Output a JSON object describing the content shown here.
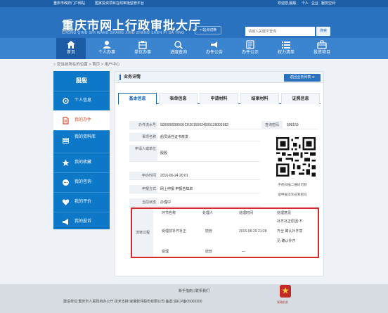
{
  "topbar": {
    "links_left": [
      "重庆市政府门户网站",
      "国家投资项目在线审批监管平台"
    ],
    "links_right": [
      "欢迎您,殷殷",
      "个人",
      "企业",
      "服务空间"
    ]
  },
  "header": {
    "logo_cn": "重庆市网上行政审批大厅",
    "logo_en": "CHONG QING SHI WANG SHANG XING ZHENG SHEN PI DA TING",
    "site_switch": "站点切换",
    "search_placeholder": "请输入关键字查询",
    "search_button": "搜索"
  },
  "nav": {
    "items": [
      {
        "label": "首页",
        "icon": "home-icon",
        "active": true
      },
      {
        "label": "个人办事",
        "icon": "person-icon",
        "active": false
      },
      {
        "label": "单位办事",
        "icon": "org-icon",
        "active": false
      },
      {
        "label": "进度查询",
        "icon": "progress-icon",
        "active": false
      },
      {
        "label": "办件公告",
        "icon": "notice-icon",
        "active": false
      },
      {
        "label": "办件公示",
        "icon": "publicity-icon",
        "active": false
      },
      {
        "label": "权力清单",
        "icon": "list-icon",
        "active": false
      },
      {
        "label": "投资项目",
        "icon": "invest-icon",
        "active": false
      }
    ]
  },
  "breadcrumb": {
    "prefix": "您当前所在的位置",
    "home": "首页",
    "current": "用户中心"
  },
  "sidebar": {
    "user": "殷殷",
    "items": [
      {
        "label": "个人信息",
        "icon": "gear-icon",
        "active": false
      },
      {
        "label": "我的办件",
        "icon": "document-icon",
        "active": true
      },
      {
        "label": "我的资料库",
        "icon": "library-icon",
        "active": false
      },
      {
        "label": "我的收藏",
        "icon": "star-icon",
        "active": false
      },
      {
        "label": "我的咨询",
        "icon": "chat-icon",
        "active": false
      },
      {
        "label": "我的评价",
        "icon": "heart-icon",
        "active": false
      },
      {
        "label": "我的投诉",
        "icon": "megaphone-icon",
        "active": false
      }
    ]
  },
  "detail": {
    "title": "业务详情",
    "return_button": "返回业务列表 ➡",
    "tabs": [
      "基本信息",
      "表单信息",
      "申请材料",
      "结果材料",
      "证照信息"
    ],
    "fields": [
      {
        "label": "办件流水号",
        "value": "5000000080XKCK20160624000139001682"
      },
      {
        "label": "事项名称",
        "value": "船员适任证书核发"
      },
      {
        "label": "申请人或单位",
        "value": "殷殷"
      },
      {
        "label": "申办时间",
        "value": "2016-06-24 20:01"
      },
      {
        "label": "申报方式",
        "value": "网上申报  申报告知单"
      },
      {
        "label": "当前状态",
        "value": "办理中"
      }
    ],
    "query_code_label": "查询密码",
    "query_code_value": "508159",
    "qr_caption_1": "手机扫描二维码可获",
    "qr_caption_2": "取申报流水号和密码"
  },
  "flow": {
    "label": "流转过程",
    "headers": [
      "环节名称",
      "处理人",
      "处理时间",
      "处理意见"
    ],
    "rows": [
      {
        "step": "受理前补齐补正",
        "handler": "唐管",
        "time": "2016-06-29 21:28",
        "opinion_1": "补齐补正原因:不",
        "opinion_2": "齐全  确认补齐意",
        "opinion_3": "见:确认补齐"
      },
      {
        "step": "受理",
        "handler": "唐管",
        "time": "—",
        "opinion_1": "",
        "opinion_2": "",
        "opinion_3": ""
      }
    ]
  },
  "footer": {
    "links": "新手指南 | 联系我们",
    "info": "建设单位:重庆市人民政府办公厅   技术支持:浪潮软件股份有限公司   备案:渝ICP备05003300",
    "badge": "党政机关"
  },
  "colors": {
    "primary": "#2a72c0",
    "sidebar": "#0d77c8",
    "active_text": "#d94c2b",
    "flow_border": "#d62a2a"
  }
}
